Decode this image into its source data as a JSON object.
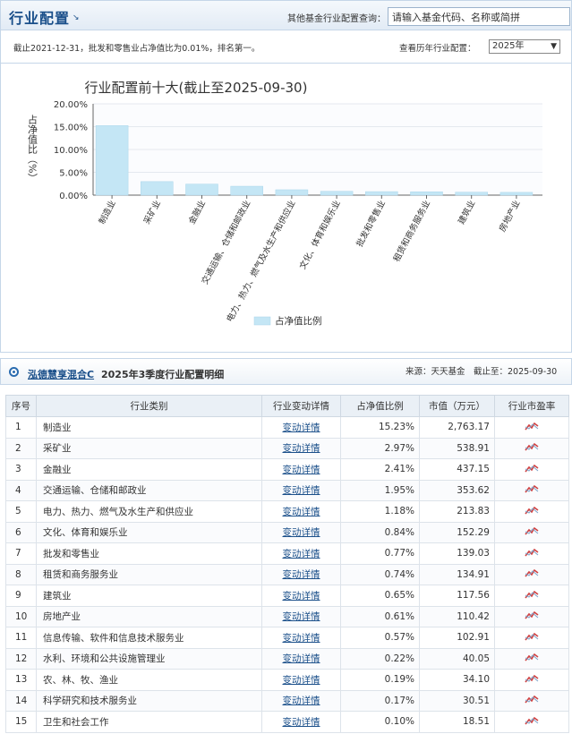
{
  "header": {
    "title": "行业配置",
    "query_label": "其他基金行业配置查询：",
    "search_placeholder": "请输入基金代码、名称或简拼"
  },
  "panel": {
    "note": "截止2021-12-31，批发和零售业占净值比为0.01%，排名第一。",
    "select_label": "查看历年行业配置：",
    "select_value": "2025年"
  },
  "chart_data": {
    "type": "bar",
    "title": "行业配置前十大(截止至2025-09-30)",
    "ylabel": "占净值比（%）",
    "ylim": [
      0,
      20
    ],
    "yticks": [
      "0.00%",
      "5.00%",
      "10.00%",
      "15.00%",
      "20.00%"
    ],
    "categories": [
      "制造业",
      "采矿业",
      "金融业",
      "交通运输、仓储和邮政业",
      "电力、热力、燃气及水生产和供应业",
      "文化、体育和娱乐业",
      "批发和零售业",
      "租赁和商务服务业",
      "建筑业",
      "房地产业"
    ],
    "series": [
      {
        "name": "占净值比例",
        "values": [
          15.23,
          2.97,
          2.41,
          1.95,
          1.18,
          0.84,
          0.77,
          0.74,
          0.65,
          0.61
        ]
      }
    ],
    "bar_color": "#c4e6f5",
    "grid": true,
    "legend": "bottom"
  },
  "detail": {
    "fund_name": "泓德慧享混合C",
    "title": "2025年3季度行业配置明细",
    "source": "来源：天天基金　截止至：2025-09-30",
    "columns": [
      "序号",
      "行业类别",
      "行业变动详情",
      "占净值比例",
      "市值（万元）",
      "行业市盈率"
    ],
    "link_label": "变动详情",
    "rows": [
      {
        "no": "1",
        "industry": "制造业",
        "pct": "15.23%",
        "value": "2,763.17"
      },
      {
        "no": "2",
        "industry": "采矿业",
        "pct": "2.97%",
        "value": "538.91"
      },
      {
        "no": "3",
        "industry": "金融业",
        "pct": "2.41%",
        "value": "437.15"
      },
      {
        "no": "4",
        "industry": "交通运输、仓储和邮政业",
        "pct": "1.95%",
        "value": "353.62"
      },
      {
        "no": "5",
        "industry": "电力、热力、燃气及水生产和供应业",
        "pct": "1.18%",
        "value": "213.83"
      },
      {
        "no": "6",
        "industry": "文化、体育和娱乐业",
        "pct": "0.84%",
        "value": "152.29"
      },
      {
        "no": "7",
        "industry": "批发和零售业",
        "pct": "0.77%",
        "value": "139.03"
      },
      {
        "no": "8",
        "industry": "租赁和商务服务业",
        "pct": "0.74%",
        "value": "134.91"
      },
      {
        "no": "9",
        "industry": "建筑业",
        "pct": "0.65%",
        "value": "117.56"
      },
      {
        "no": "10",
        "industry": "房地产业",
        "pct": "0.61%",
        "value": "110.42"
      },
      {
        "no": "11",
        "industry": "信息传输、软件和信息技术服务业",
        "pct": "0.57%",
        "value": "102.91"
      },
      {
        "no": "12",
        "industry": "水利、环境和公共设施管理业",
        "pct": "0.22%",
        "value": "40.05"
      },
      {
        "no": "13",
        "industry": "农、林、牧、渔业",
        "pct": "0.19%",
        "value": "34.10"
      },
      {
        "no": "14",
        "industry": "科学研究和技术服务业",
        "pct": "0.17%",
        "value": "30.51"
      },
      {
        "no": "15",
        "industry": "卫生和社会工作",
        "pct": "0.10%",
        "value": "18.51"
      }
    ],
    "pe_icon": "trend-chart-icon"
  }
}
